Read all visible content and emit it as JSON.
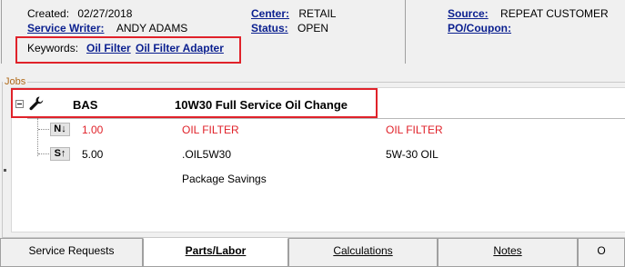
{
  "info": {
    "created_label": "Created:",
    "created_value": "02/27/2018",
    "service_writer_label": "Service Writer:",
    "service_writer_value": "ANDY ADAMS",
    "center_label": "Center:",
    "center_value": "RETAIL",
    "status_label": "Status:",
    "status_value": "OPEN",
    "source_label": "Source:",
    "source_value": "REPEAT CUSTOMER",
    "po_label": "PO/Coupon:",
    "po_value": ""
  },
  "keywords": {
    "label": "Keywords:",
    "items": [
      "Oil Filter",
      "Oil Filter Adapter"
    ]
  },
  "jobs": {
    "legend": "Jobs",
    "job": {
      "code": "BAS",
      "description": "10W30 Full Service Oil Change"
    },
    "lines": [
      {
        "badge": "N↓",
        "qty": "1.00",
        "part": "OIL FILTER",
        "desc": "OIL FILTER",
        "highlight": true
      },
      {
        "badge": "S↑",
        "qty": "5.00",
        "part": ".OIL5W30",
        "desc": "5W-30 OIL",
        "highlight": false
      }
    ],
    "package_savings": "Package Savings"
  },
  "tabs": [
    {
      "label": "Service Requests",
      "active": false
    },
    {
      "label": "Parts/Labor",
      "active": true
    },
    {
      "label": "Calculations",
      "active": false
    },
    {
      "label": "Notes",
      "active": false
    },
    {
      "label": "O",
      "active": false
    }
  ],
  "colors": {
    "link": "#0a1f8f",
    "highlight_red": "#e0222a",
    "legend": "#b06a1a"
  }
}
